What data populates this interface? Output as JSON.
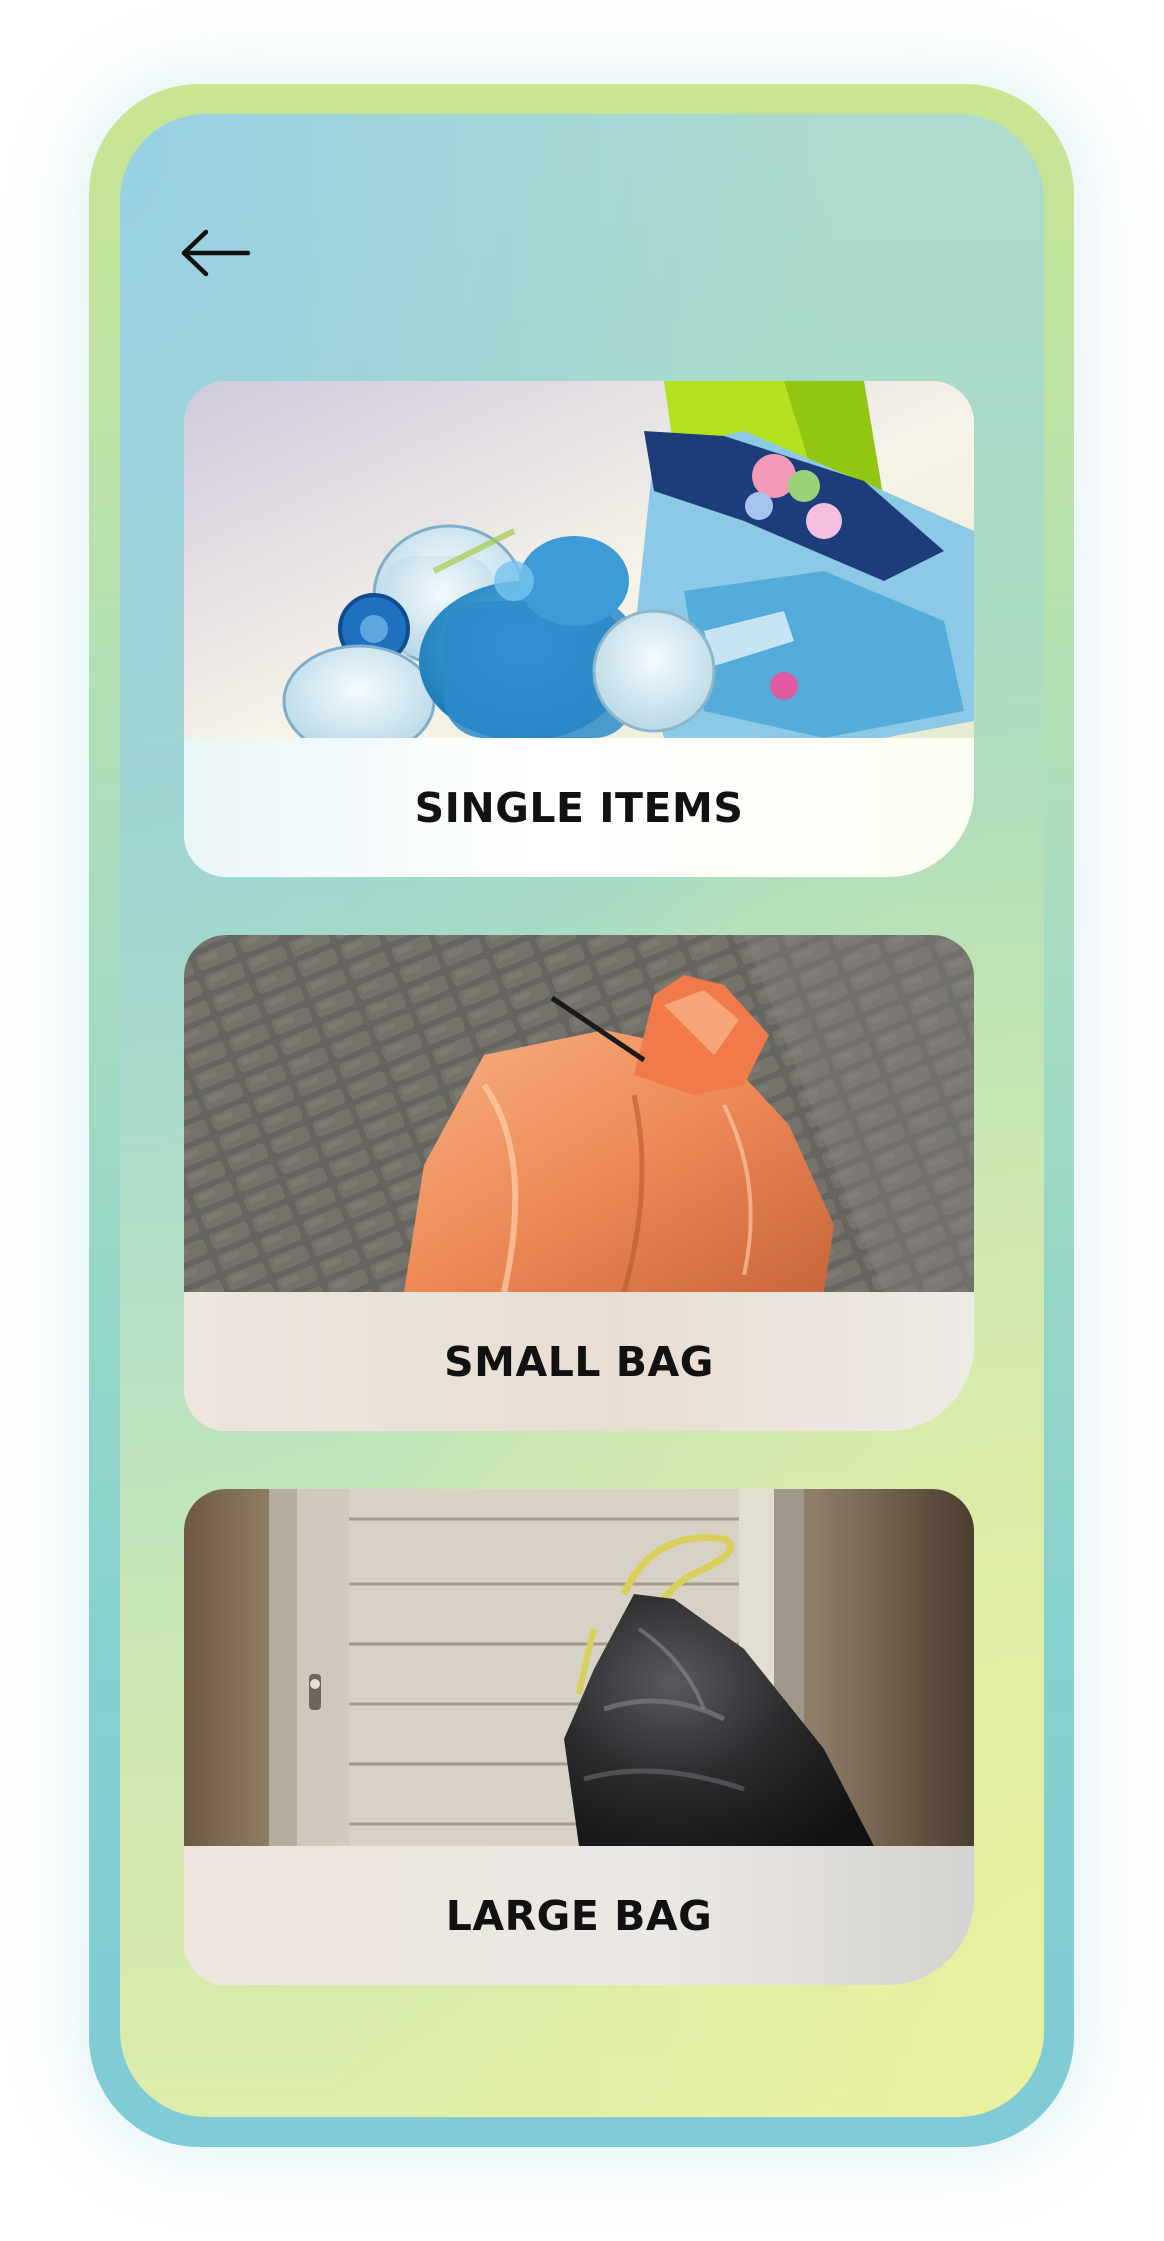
{
  "header": {
    "back_icon": "arrow-left-icon"
  },
  "options": [
    {
      "label": "SINGLE ITEMS",
      "image": "plastic-bottles-photo"
    },
    {
      "label": "SMALL BAG",
      "image": "orange-trash-bag-photo"
    },
    {
      "label": "LARGE BAG",
      "image": "black-trash-bag-photo"
    }
  ],
  "colors": {
    "frame_top": "#c9e592",
    "frame_bottom": "#7fcbd6",
    "label_text": "#111111"
  }
}
